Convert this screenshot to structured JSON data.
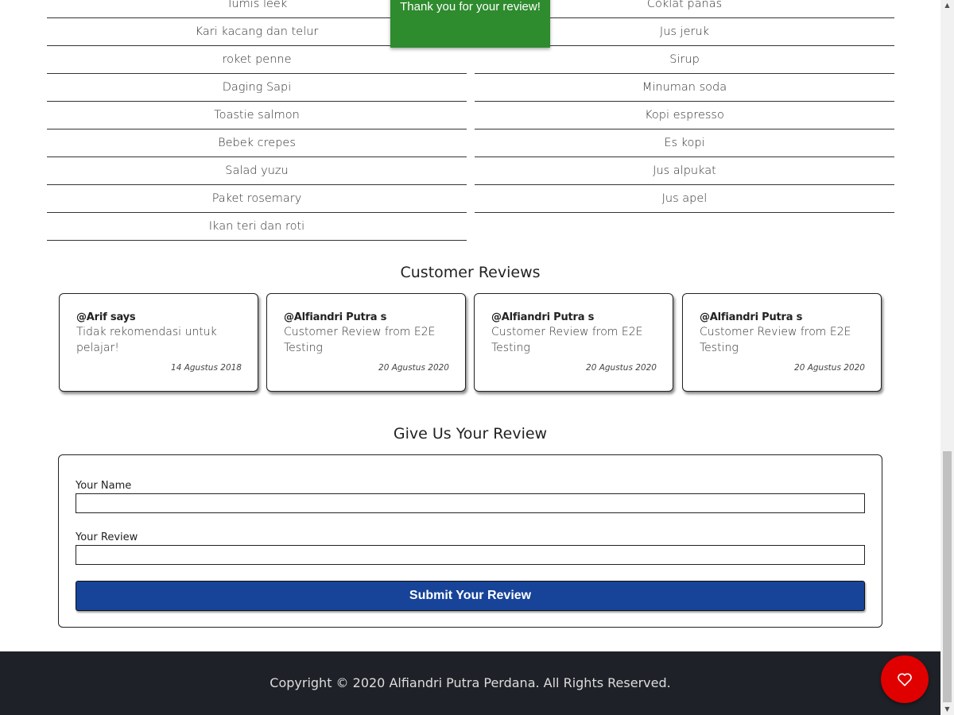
{
  "menu": {
    "food": [
      "Tumis leek",
      "Kari kacang dan telur",
      "roket penne",
      "Daging Sapi",
      "Toastie salmon",
      "Bebek crepes",
      "Salad yuzu",
      "Paket rosemary",
      "Ikan teri dan roti"
    ],
    "drinks": [
      "Coklat panas",
      "Jus jeruk",
      "Sirup",
      "Minuman soda",
      "Kopi espresso",
      "Es kopi",
      "Jus alpukat",
      "Jus apel"
    ]
  },
  "toast": {
    "message": "Thank you for your review!"
  },
  "reviews": {
    "title": "Customer Reviews",
    "items": [
      {
        "author": "@Arif says",
        "text": "Tidak rekomendasi untuk pelajar!",
        "date": "14 Agustus 2018"
      },
      {
        "author": "@Alfiandri Putra says",
        "text": "Customer Review from E2E Testing",
        "date": "20 Agustus 2020"
      },
      {
        "author": "@Alfiandri Putra says",
        "text": "Customer Review from E2E Testing",
        "date": "20 Agustus 2020"
      },
      {
        "author": "@Alfiandri Putra says",
        "text": "Customer Review from E2E Testing",
        "date": "20 Agustus 2020"
      }
    ]
  },
  "review_form": {
    "title": "Give Us Your Review",
    "name_label": "Your Name",
    "name_value": "",
    "review_label": "Your Review",
    "review_value": "",
    "submit_label": "Submit Your Review"
  },
  "footer": {
    "copyright": "Copyright © 2020 Alfiandri Putra Perdana. All Rights Reserved."
  },
  "fab": {
    "icon": "heart-icon",
    "color": "#e00000"
  },
  "colors": {
    "toast": "#2e8b2e",
    "submit": "#174499",
    "footer": "#1e2127"
  }
}
